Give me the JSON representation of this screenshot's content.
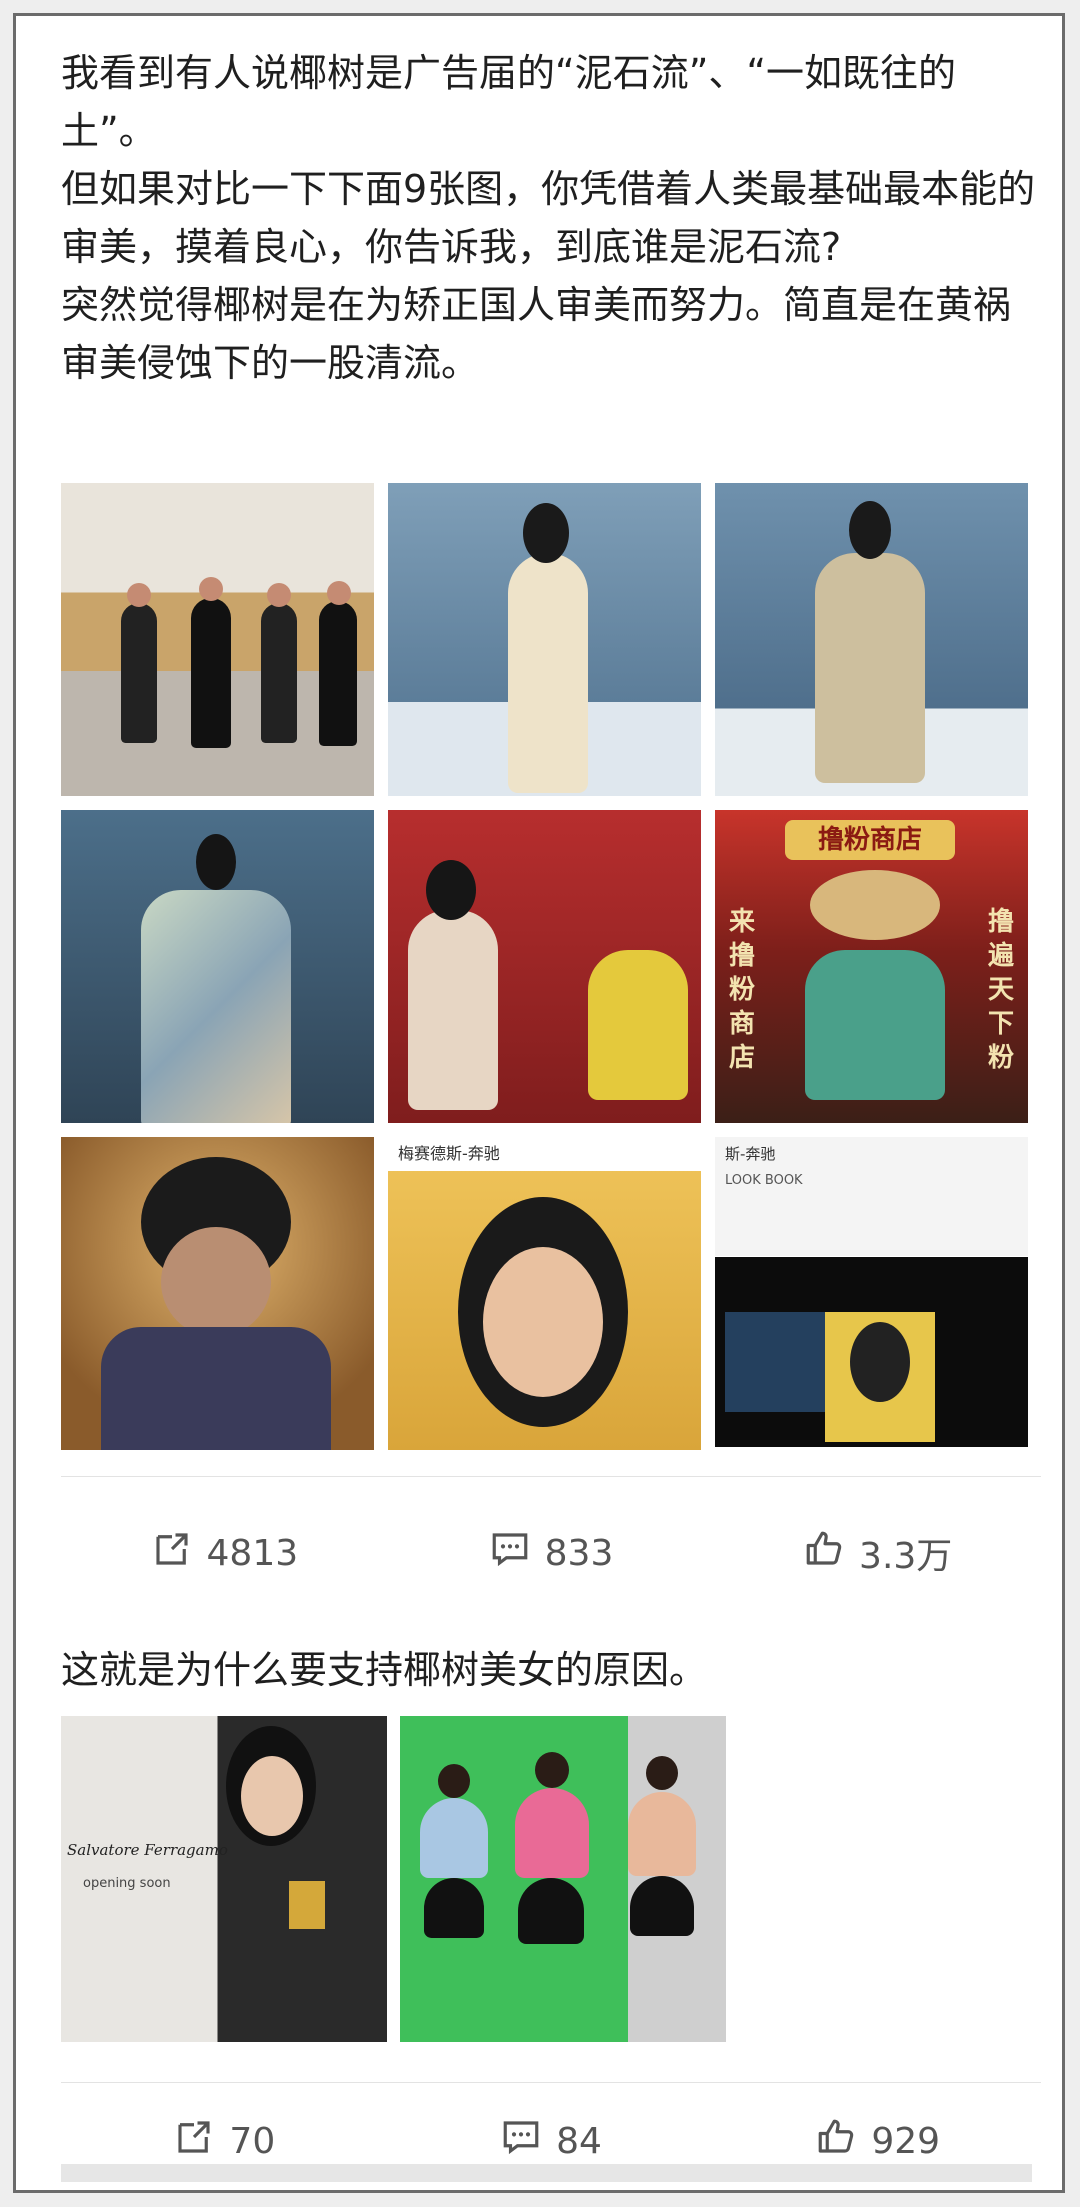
{
  "post1": {
    "paragraphs": [
      "我看到有人说椰树是广告届的“泥石流”、“一如既往的土”。",
      "但如果对比一下下面9张图，你凭借着人类最基础最本能的审美，摸着良心，你告诉我，到底谁是泥石流?",
      "突然觉得椰树是在为矫正国人审美而努力。简直是在黄祸审美侵蚀下的一股清流。"
    ],
    "images": [
      {
        "name": "warehouse-dance-photo",
        "texts": []
      },
      {
        "name": "blue-studio-model-photo",
        "texts": []
      },
      {
        "name": "floral-dress-model-photo",
        "texts": []
      },
      {
        "name": "runway-print-dress-photo",
        "texts": []
      },
      {
        "name": "red-room-campaign-photo",
        "texts": []
      },
      {
        "name": "rice-noodle-shop-ad",
        "texts": [
          "撸粉商店",
          "来撸粉商店",
          "撸遍天下粉"
        ]
      },
      {
        "name": "golden-portrait-photo",
        "texts": []
      },
      {
        "name": "benz-ad-screenshot",
        "texts": [
          "梅赛德斯-奔驰"
        ]
      },
      {
        "name": "benz-lookbook-screenshot",
        "texts": [
          "斯-奔驰",
          "LOOK BOOK"
        ]
      }
    ],
    "actions": {
      "repost": "4813",
      "comment": "833",
      "like": "3.3万"
    }
  },
  "post2": {
    "paragraphs": [
      "这就是为什么要支持椰树美女的原因。"
    ],
    "images": [
      {
        "name": "ferragamo-store-photo",
        "texts": [
          "Salvatore Ferragamo",
          "opening soon"
        ]
      },
      {
        "name": "green-screen-models-photo",
        "texts": []
      }
    ],
    "actions": {
      "repost": "70",
      "comment": "84",
      "like": "929"
    }
  },
  "colors": {
    "text": "#1f1f1f",
    "icon": "#555555",
    "divider": "#e3e3e3",
    "frame": "#6b6b6b"
  },
  "icons": {
    "repost": "share-square-icon",
    "comment": "comment-bubble-icon",
    "like": "thumbs-up-icon"
  }
}
